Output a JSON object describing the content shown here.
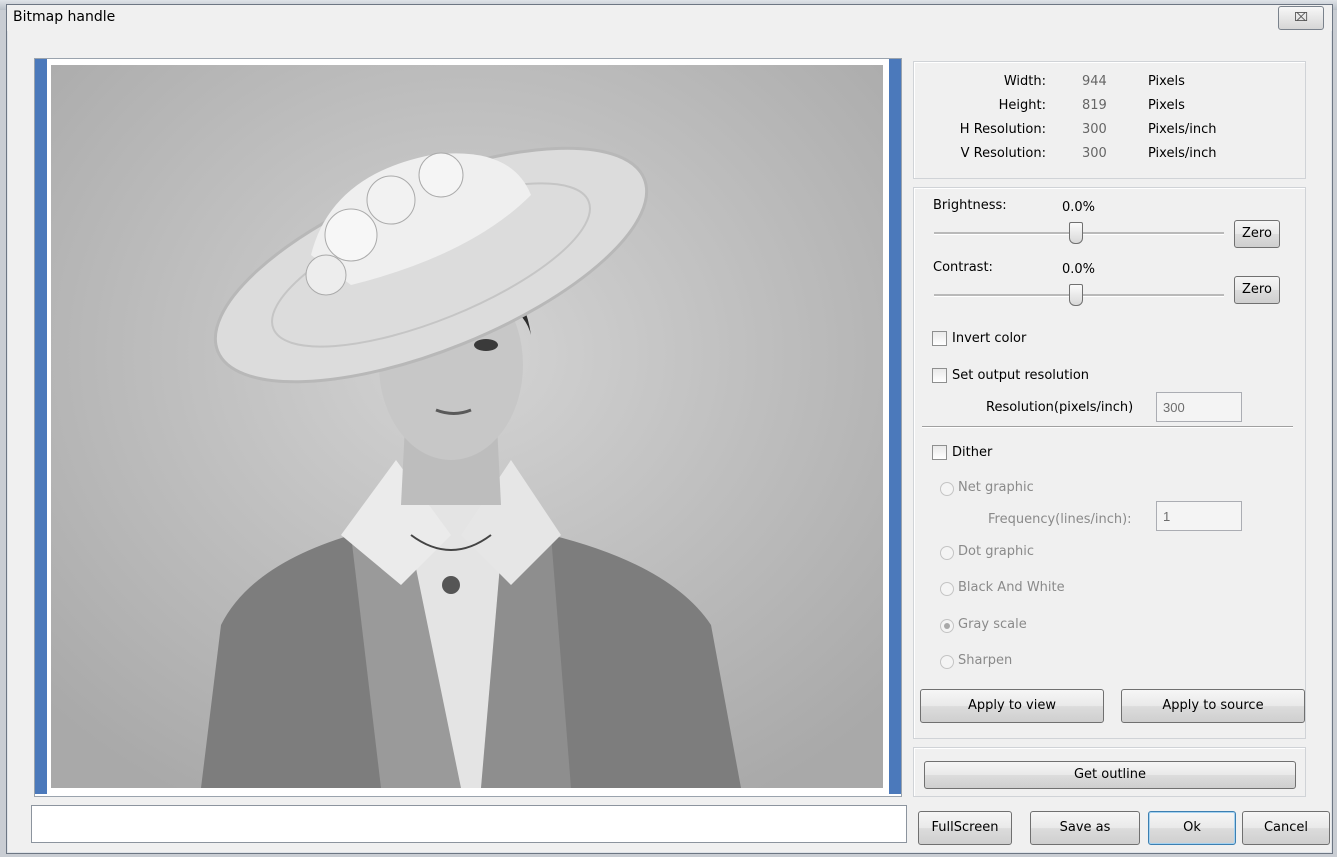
{
  "window": {
    "title": "Bitmap handle",
    "close_glyph": "⌧"
  },
  "image_info": [
    {
      "label": "Width:",
      "value": "944",
      "unit": "Pixels"
    },
    {
      "label": "Height:",
      "value": "819",
      "unit": "Pixels"
    },
    {
      "label": "H Resolution:",
      "value": "300",
      "unit": "Pixels/inch"
    },
    {
      "label": "V Resolution:",
      "value": "300",
      "unit": "Pixels/inch"
    }
  ],
  "adjust": {
    "brightness_label": "Brightness:",
    "brightness_value": "0.0%",
    "brightness_level": 0.5,
    "contrast_label": "Contrast:",
    "contrast_value": "0.0%",
    "contrast_level": 0.5,
    "zero_label": "Zero",
    "invert_label": "Invert color",
    "invert_checked": false,
    "set_output_label": "Set output resolution",
    "set_output_checked": false,
    "resolution_label": "Resolution(pixels/inch)",
    "resolution_value": "300"
  },
  "dither": {
    "label": "Dither",
    "checked": false,
    "net_graphic": "Net graphic",
    "frequency_label": "Frequency(lines/inch):",
    "frequency_value": "1",
    "dot_graphic": "Dot graphic",
    "black_white": "Black And White",
    "gray_scale": "Gray scale",
    "sharpen": "Sharpen",
    "selected": "Gray scale"
  },
  "buttons": {
    "apply_view": "Apply to view",
    "apply_source": "Apply to source",
    "get_outline": "Get outline",
    "fullscreen": "FullScreen",
    "save_as": "Save as",
    "ok": "Ok",
    "cancel": "Cancel"
  },
  "colors": {
    "preview_border": "#4b79bb",
    "dialog_bg": "#f0f0f0"
  }
}
